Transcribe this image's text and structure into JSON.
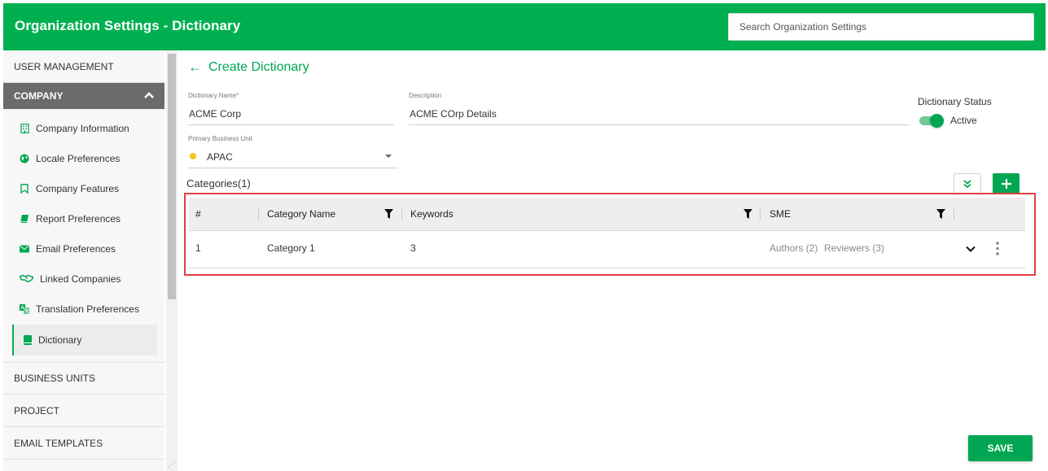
{
  "header": {
    "title": "Organization Settings - Dictionary",
    "search_placeholder": "Search Organization Settings"
  },
  "sidebar": {
    "sections": [
      {
        "label": "USER MANAGEMENT"
      },
      {
        "label": "COMPANY"
      },
      {
        "label": "BUSINESS UNITS"
      },
      {
        "label": "PROJECT"
      },
      {
        "label": "EMAIL TEMPLATES"
      }
    ],
    "company_items": [
      {
        "label": "Company Information",
        "icon": "building-icon"
      },
      {
        "label": "Locale Preferences",
        "icon": "globe-icon"
      },
      {
        "label": "Company Features",
        "icon": "bookmark-icon"
      },
      {
        "label": "Report Preferences",
        "icon": "book-icon"
      },
      {
        "label": "Email Preferences",
        "icon": "envelope-icon"
      },
      {
        "label": "Linked Companies",
        "icon": "handshake-icon"
      },
      {
        "label": "Translation Preferences",
        "icon": "translate-icon"
      },
      {
        "label": "Dictionary",
        "icon": "dictionary-icon"
      }
    ],
    "selected_item": "Dictionary"
  },
  "form": {
    "back_label": "Create Dictionary",
    "name_label": "Dictionary Name",
    "name_required_mark": "*",
    "name_value": "ACME Corp",
    "description_label": "Description",
    "description_value": "ACME COrp Details",
    "status_label": "Dictionary Status",
    "status_value": "Active",
    "status_on": true,
    "bu_label": "Primary Business Unit",
    "bu_value": "APAC",
    "categories_label": "Categories(1)"
  },
  "table": {
    "columns": [
      "#",
      "Category Name",
      "Keywords",
      "SME"
    ],
    "rows": [
      {
        "index": "1",
        "category_name": "Category 1",
        "keywords": "3",
        "authors": "Authors (2)",
        "reviewers": "Reviewers (3)"
      }
    ]
  },
  "actions": {
    "save_label": "SAVE"
  },
  "colors": {
    "brand_green": "#00b050",
    "accent_green": "#00a651",
    "highlight_red": "#e04040",
    "bu_dot": "#f5c518"
  }
}
